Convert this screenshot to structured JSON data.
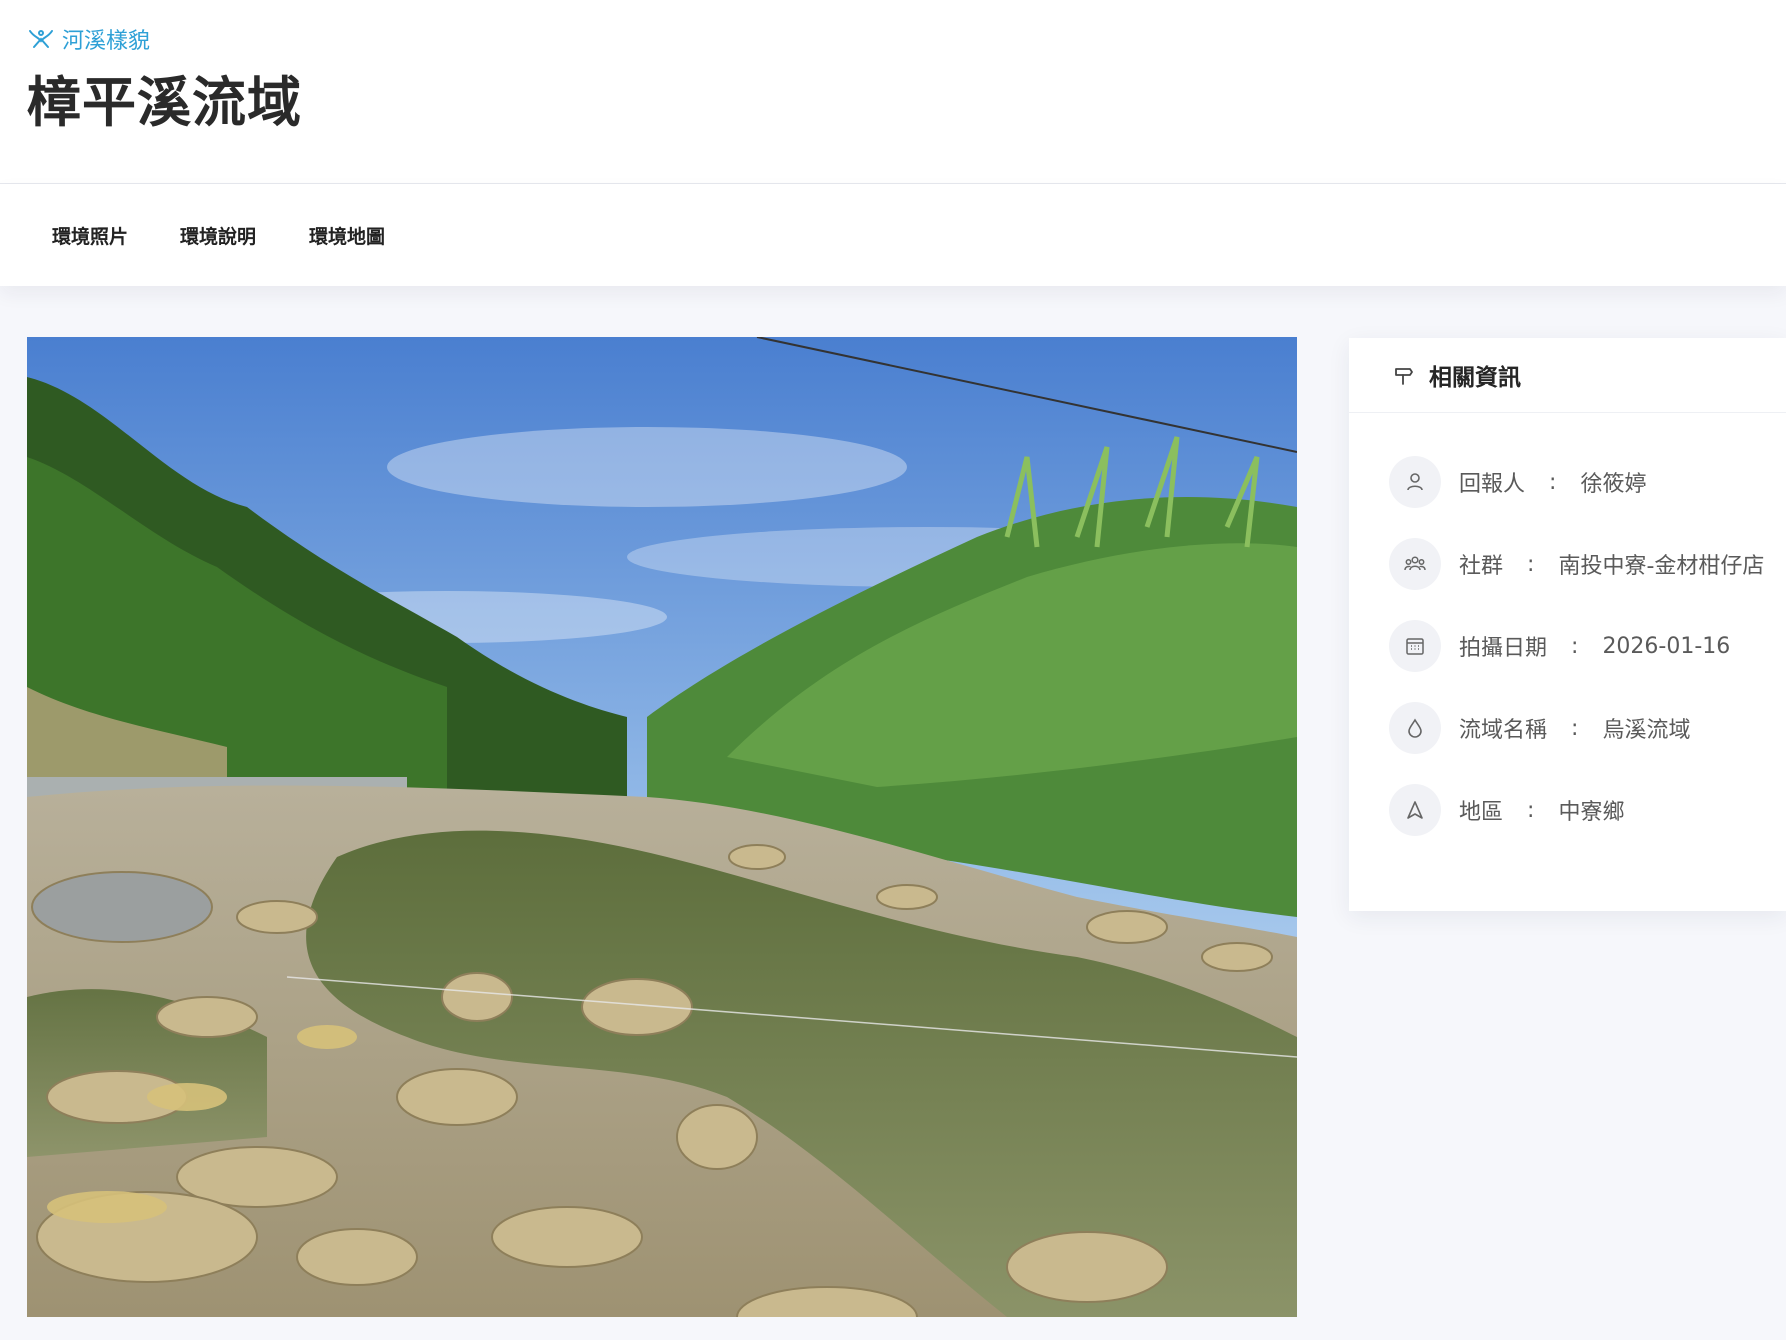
{
  "header": {
    "eyebrow_label": "河溪樣貌",
    "title": "樟平溪流域"
  },
  "tabs": [
    {
      "label": "環境照片"
    },
    {
      "label": "環境說明"
    },
    {
      "label": "環境地圖"
    }
  ],
  "sidebar": {
    "title": "相關資訊",
    "items": [
      {
        "icon": "user-icon",
        "label": "回報人",
        "value": "徐筱婷"
      },
      {
        "icon": "group-icon",
        "label": "社群",
        "value": "南投中寮-金材柑仔店"
      },
      {
        "icon": "calendar-icon",
        "label": "拍攝日期",
        "value": "2026-01-16"
      },
      {
        "icon": "water-drop-icon",
        "label": "流域名稱",
        "value": "烏溪流域"
      },
      {
        "icon": "location-icon",
        "label": "地區",
        "value": "中寮鄉"
      }
    ],
    "separator": ":"
  },
  "colors": {
    "accent": "#2ea0d6",
    "page_bg": "#f6f7fb"
  }
}
